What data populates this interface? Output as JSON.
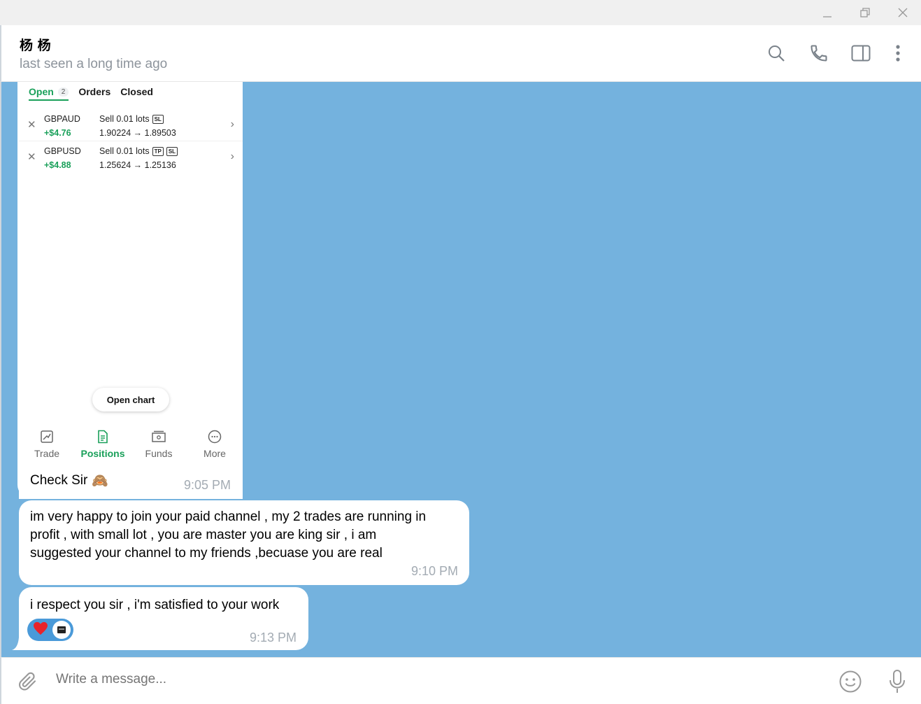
{
  "window": {
    "icons": [
      "minimize-icon",
      "restore-icon",
      "close-icon"
    ]
  },
  "header": {
    "name": "杨 杨",
    "status": "last seen a long time ago",
    "icons": [
      "search-icon",
      "phone-icon",
      "sidebar-toggle-icon",
      "more-vertical-icon"
    ]
  },
  "media": {
    "tabs": {
      "open": "Open",
      "open_count": "2",
      "orders": "Orders",
      "closed": "Closed"
    },
    "trades": [
      {
        "pair": "GBPAUD",
        "pnl": "+$4.76",
        "side": "Sell 0.01 lots",
        "tags": [
          "SL"
        ],
        "price": "1.90224 → 1.89503"
      },
      {
        "pair": "GBPUSD",
        "pnl": "+$4.88",
        "side": "Sell 0.01 lots",
        "tags": [
          "TP",
          "SL"
        ],
        "price": "1.25624 → 1.25136"
      }
    ],
    "open_chart": "Open chart",
    "nav": [
      {
        "label": "Trade",
        "icon": "trade-chart-icon"
      },
      {
        "label": "Positions",
        "icon": "positions-document-icon"
      },
      {
        "label": "Funds",
        "icon": "funds-wallet-icon"
      },
      {
        "label": "More",
        "icon": "more-circle-icon"
      }
    ]
  },
  "messages": [
    {
      "caption": "Check Sir",
      "emoji": "🙈",
      "time": "9:05 PM"
    },
    {
      "lines": [
        "im very happy to join your paid channel , my 2 trades are running in",
        "profit , with small lot , you are master you are king sir , i am",
        "suggested your channel to my friends ,becuase you are real"
      ],
      "time": "9:10 PM"
    },
    {
      "text": "i respect you sir , i'm satisfied to your work",
      "reaction": "❤️",
      "time": "9:13 PM"
    }
  ],
  "composer": {
    "placeholder": "Write a message...",
    "icons": [
      "attach-icon",
      "emoji-icon",
      "microphone-icon"
    ]
  },
  "colors": {
    "chat_background": "#74b2de",
    "accent_green": "#1aa05a",
    "reaction_pill": "#4a9ad9"
  }
}
